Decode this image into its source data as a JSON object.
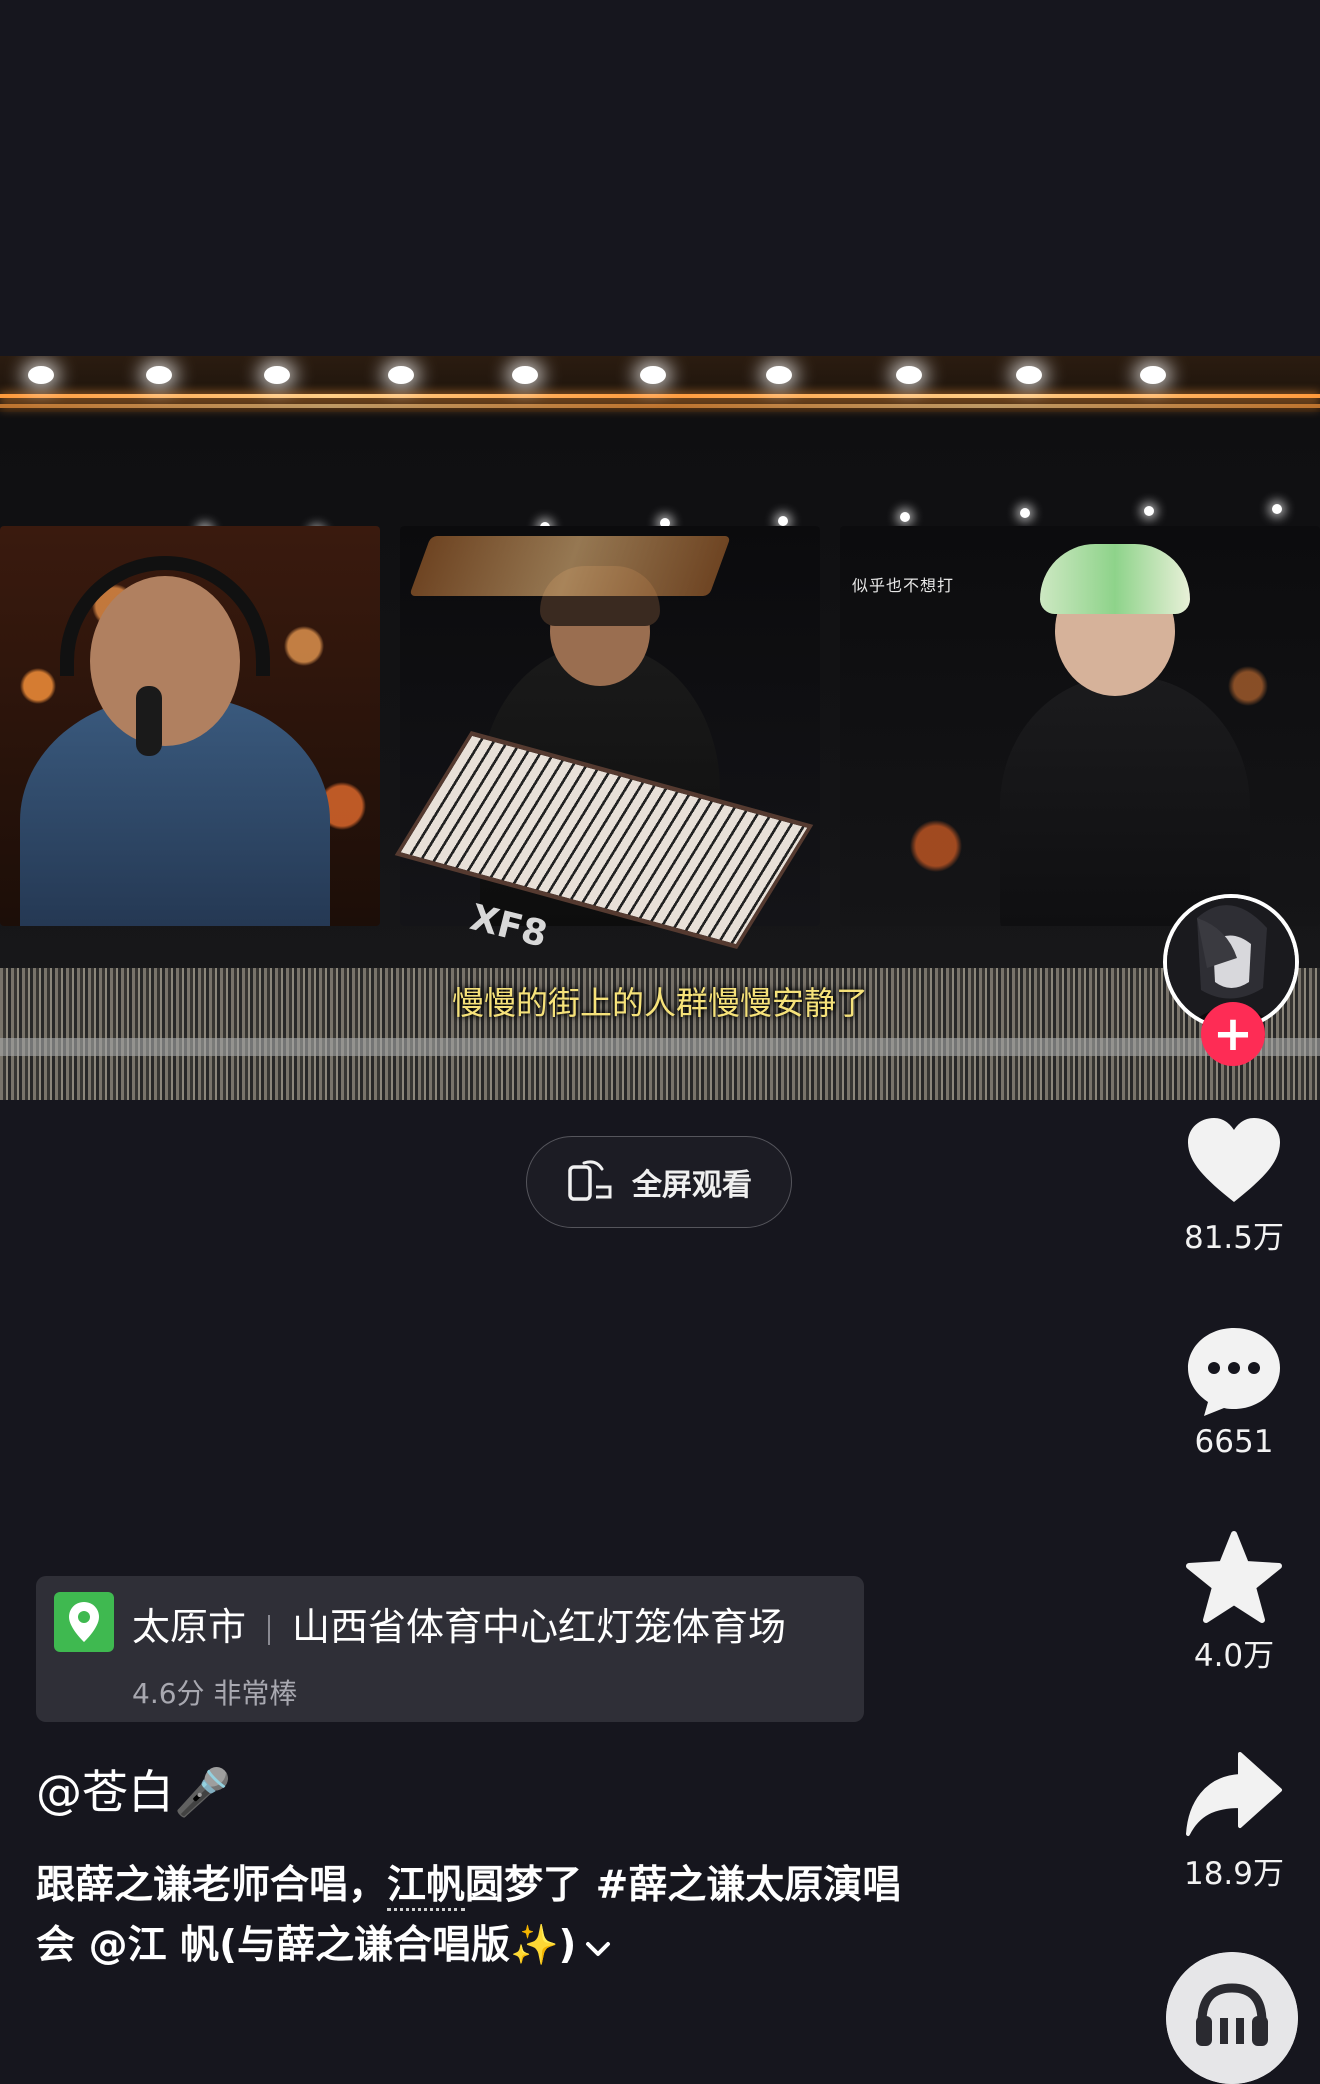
{
  "video": {
    "subtitle": "慢慢的街上的人群慢慢安静了",
    "screen_text": "似乎也不想打",
    "keyboard_text": "XF8"
  },
  "fullscreen": {
    "label": "全屏观看",
    "icon": "rotate-phone-icon"
  },
  "creator": {
    "avatar": "avatar",
    "follow_icon": "plus-icon",
    "follow_color": "#fe2c55"
  },
  "actions": {
    "like": {
      "icon": "heart-icon",
      "count": "81.5万"
    },
    "comment": {
      "icon": "comment-bubble-icon",
      "count": "6651"
    },
    "favorite": {
      "icon": "star-icon",
      "count": "4.0万"
    },
    "share": {
      "icon": "share-arrow-icon",
      "count": "18.9万"
    },
    "music": {
      "icon": "music-disc-icon"
    }
  },
  "poi": {
    "icon": "location-pin-icon",
    "icon_color": "#3fb950",
    "city": "太原市",
    "venue": "山西省体育中心红灯笼体育场",
    "rating": "4.6分 非常棒"
  },
  "caption": {
    "author": "@苍白🎤",
    "text_1": "跟薛之谦老师合唱，",
    "underlined": "江帆",
    "text_2": "圆梦了 ",
    "hashtag_1": "#薛之谦太原演唱",
    "line2_a": "会 ",
    "mention": "@江 帆(与薛之谦合唱版✨)",
    "expand_icon": "chevron-down-icon"
  }
}
